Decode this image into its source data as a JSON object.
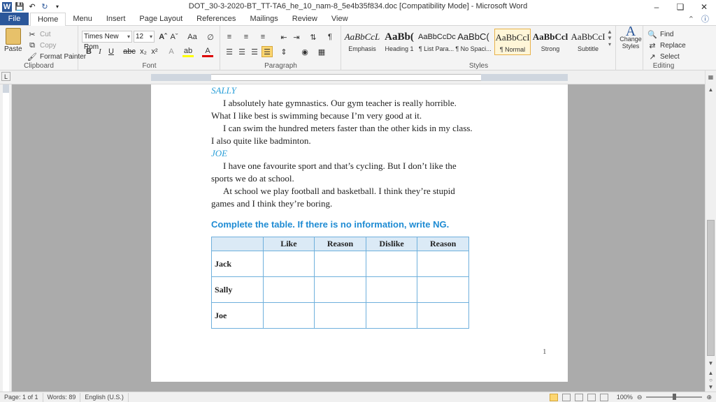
{
  "window": {
    "title": "DOT_30-3-2020-BT_TT-TA6_he_10_nam-8_5e4b35f834.doc [Compatibility Mode]  -  Microsoft Word",
    "minimize": "–",
    "restore": "❏",
    "close": "✕"
  },
  "tabs": [
    "File",
    "Home",
    "Menu",
    "Insert",
    "Page Layout",
    "References",
    "Mailings",
    "Review",
    "View"
  ],
  "ribbon": {
    "clipboard": {
      "paste": "Paste",
      "cut": "Cut",
      "copy": "Copy",
      "format_painter": "Format Painter",
      "label": "Clipboard"
    },
    "font": {
      "name": "Times New Rom",
      "size": "12",
      "label": "Font"
    },
    "paragraph": {
      "label": "Paragraph"
    },
    "styles": {
      "label": "Styles",
      "items": [
        {
          "sample": "AaBbCcL",
          "name": "Emphasis"
        },
        {
          "sample": "AaBb(",
          "name": "Heading 1"
        },
        {
          "sample": "AaBbCcDc",
          "name": "¶ List Para..."
        },
        {
          "sample": "AaBbC(",
          "name": "¶ No Spaci..."
        },
        {
          "sample": "AaBbCcI",
          "name": "¶ Normal"
        },
        {
          "sample": "AaBbCcl",
          "name": "Strong"
        },
        {
          "sample": "AaBbCcI",
          "name": "Subtitle"
        }
      ],
      "change_styles": "Change Styles"
    },
    "editing": {
      "find": "Find",
      "replace": "Replace",
      "select": "Select",
      "label": "Editing"
    }
  },
  "document": {
    "speaker_sally": "SALLY",
    "p1": "I absolutely hate gymnastics. Our gym teacher is really horrible. What I like best is swimming because I’m very good at it.",
    "p2": "I can swim the hundred meters faster than the other kids in my class. I also quite like badminton.",
    "speaker_joe": "JOE",
    "p3": "I have one favourite sport and that’s cycling. But I don’t like the sports we do at school.",
    "p4": "At school we play football and basketball. I think they’re stupid games and I think they’re boring.",
    "task": "Complete the table. If there is no information, write NG.",
    "table": {
      "headers": [
        "",
        "Like",
        "Reason",
        "Dislike",
        "Reason"
      ],
      "rows": [
        "Jack",
        "Sally",
        "Joe"
      ]
    },
    "page_number": "1"
  },
  "status": {
    "page": "Page: 1 of 1",
    "words": "Words: 89",
    "language": "English (U.S.)",
    "zoom": "100%"
  }
}
